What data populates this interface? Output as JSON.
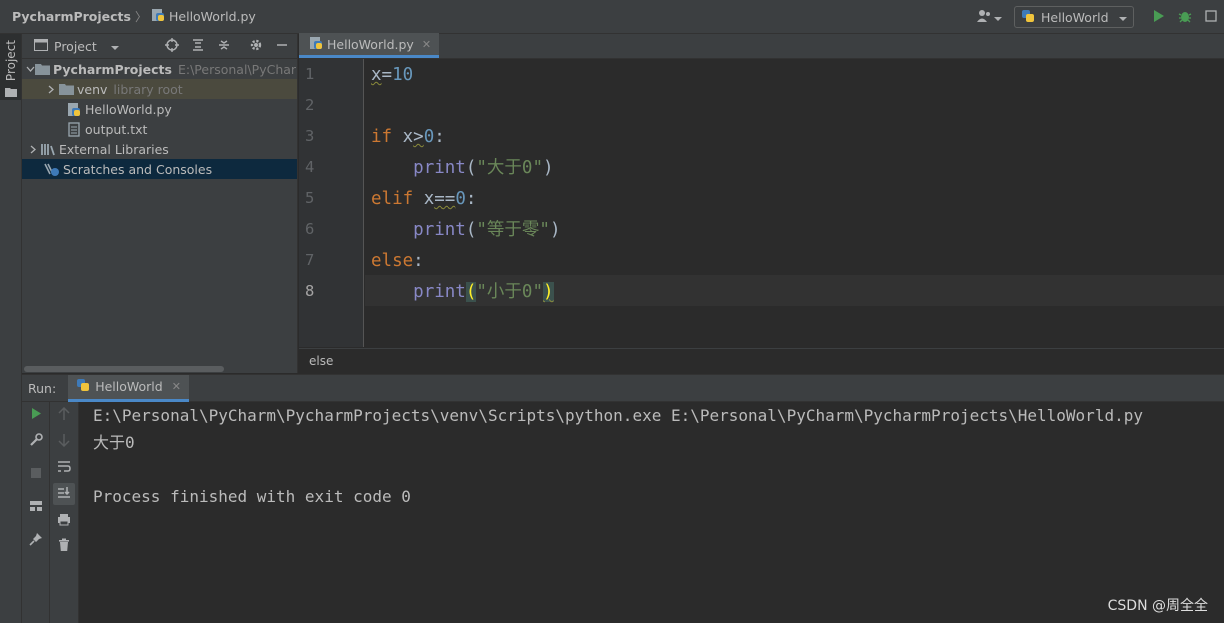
{
  "navbar": {
    "project_name": "PycharmProjects",
    "current_file": "HelloWorld.py",
    "run_config": "HelloWorld"
  },
  "left_strip": {
    "project_tab_label": "Project"
  },
  "project_panel": {
    "title": "Project",
    "tree": [
      {
        "label": "PycharmProjects",
        "extra": "E:\\Personal\\PyCharm\\",
        "icon": "folder-icon"
      },
      {
        "label": "venv",
        "extra": "library root",
        "icon": "folder-icon"
      },
      {
        "label": "HelloWorld.py",
        "extra": "",
        "icon": "python-file-icon"
      },
      {
        "label": "output.txt",
        "extra": "",
        "icon": "text-file-icon"
      },
      {
        "label": "External Libraries",
        "extra": "",
        "icon": "libraries-icon"
      },
      {
        "label": "Scratches and Consoles",
        "extra": "",
        "icon": "scratches-icon"
      }
    ]
  },
  "editor": {
    "tab_label": "HelloWorld.py",
    "line_numbers": [
      "1",
      "2",
      "3",
      "4",
      "5",
      "6",
      "7",
      "8"
    ],
    "code": {
      "l1_var": "x",
      "l1_op": "=",
      "l1_num": "10",
      "l3_kw": "if",
      "l3_var": "x",
      "l3_op": ">",
      "l3_num": "0",
      "l3_colon": ":",
      "l4_fn": "print",
      "l4_open": "(",
      "l4_str": "\"大于0\"",
      "l4_close": ")",
      "l5_kw": "elif",
      "l5_var": "x",
      "l5_op": "==",
      "l5_num": "0",
      "l5_colon": ":",
      "l6_fn": "print",
      "l6_open": "(",
      "l6_str": "\"等于零\"",
      "l6_close": ")",
      "l7_kw": "else",
      "l7_colon": ":",
      "l8_fn": "print",
      "l8_open": "(",
      "l8_str": "\"小于0\"",
      "l8_close": ")"
    },
    "breadcrumb": "else"
  },
  "run_panel": {
    "label": "Run:",
    "tab_label": "HelloWorld",
    "console": [
      "E:\\Personal\\PyCharm\\PycharmProjects\\venv\\Scripts\\python.exe E:\\Personal\\PyCharm\\PycharmProjects\\HelloWorld.py",
      "大于0",
      "",
      "Process finished with exit code 0"
    ]
  },
  "watermark": "CSDN @周全全",
  "colors": {
    "keyword": "#cc7832",
    "number": "#6897bb",
    "string": "#6a8759",
    "builtin": "#8888c6",
    "run_green": "#499c54",
    "accent_blue": "#4a88c7"
  }
}
